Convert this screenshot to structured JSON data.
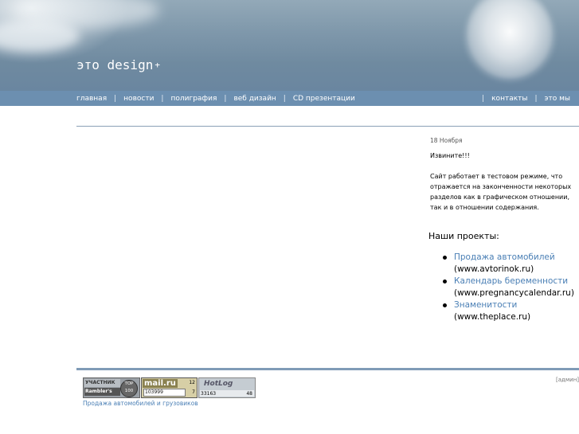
{
  "header": {
    "logo_text": "это design",
    "logo_plus": "+"
  },
  "nav": {
    "left": [
      "главная",
      "новости",
      "полиграфия",
      "веб дизайн",
      "CD презентации"
    ],
    "right": [
      "контакты",
      "это мы"
    ],
    "separator": "|"
  },
  "news": {
    "date": "18 Ноября",
    "title": "Извините!!!",
    "body": "Сайт работает в тестовом режиме, что отражается на законченности некоторых разделов как в графическом отношении, так и в отношении содержания."
  },
  "projects": {
    "title": "Наши проекты:",
    "items": [
      {
        "link": "Продажа автомобилей",
        "url_text": "(www.avtorinok.ru)"
      },
      {
        "link": "Календарь беременности",
        "url_text": "(www.pregnancycalendar.ru)"
      },
      {
        "link": "Знаменитости",
        "url_text": "(www.theplace.ru)"
      }
    ]
  },
  "footer": {
    "admin": "[админ]",
    "link": "Продажа автомобилей и грузовиков",
    "rambler": {
      "top": "УЧАСТНИК",
      "bottom": "Rambler's",
      "circle": "TOP 100"
    },
    "mailru": {
      "logo": "mail.ru",
      "num1": "12",
      "num_box": "103999",
      "num2": "7"
    },
    "hotlog": {
      "logo": "HotLog",
      "num1": "33163",
      "num2": "48"
    }
  },
  "colors": {
    "navbar": "#6c8fb0",
    "link": "#4a7fb5",
    "rule": "#7f9bb7"
  }
}
